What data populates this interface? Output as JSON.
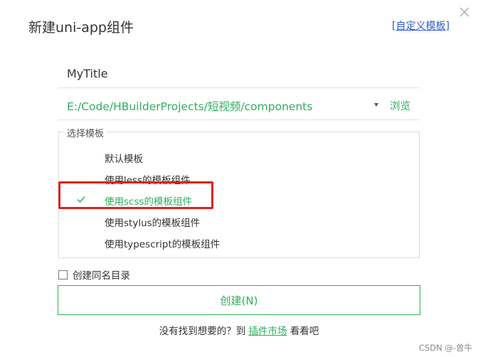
{
  "dialog": {
    "title": "新建uni-app组件",
    "custom_template_link": "[自定义模板]",
    "close_icon": "close-icon"
  },
  "form": {
    "component_name": "MyTitle",
    "path": "E:/Code/HBuilderProjects/短视频/components",
    "browse_label": "浏览"
  },
  "templates": {
    "legend": "选择模板",
    "options": [
      {
        "label": "默认模板",
        "selected": false
      },
      {
        "label": "使用less的模板组件",
        "selected": false
      },
      {
        "label": "使用scss的模板组件",
        "selected": true
      },
      {
        "label": "使用stylus的模板组件",
        "selected": false
      },
      {
        "label": "使用typescript的模板组件",
        "selected": false
      }
    ]
  },
  "same_dir": {
    "label": "创建同名目录",
    "checked": false
  },
  "create_button": "创建(N)",
  "footer": {
    "prefix": "没有找到想要的？到",
    "link": "插件市场",
    "suffix": "看看吧"
  },
  "watermark": "CSDN @-曾牛",
  "colors": {
    "accent": "#2fae5d",
    "highlight": "#e0211c",
    "link": "#2f5bd0"
  }
}
